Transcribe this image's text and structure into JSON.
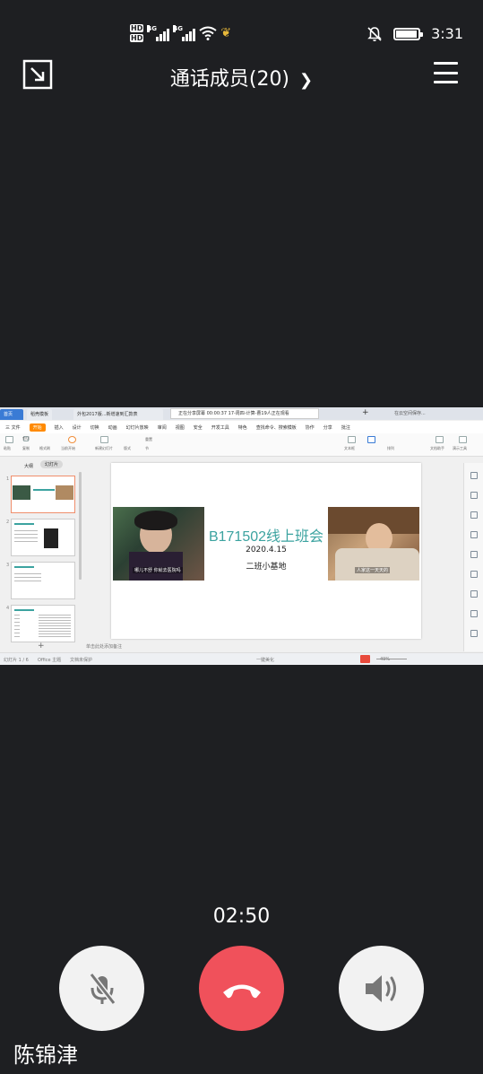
{
  "status_bar": {
    "hd1": "HD",
    "hd2": "HD",
    "net1": "4G",
    "net2": "4G",
    "time": "3:31",
    "battery_level": 0.9
  },
  "top_bar": {
    "title": "通话成员(20)",
    "chevron": "❯"
  },
  "shared_screen": {
    "tabs": {
      "home": "首页",
      "doc1": "稻壳模板",
      "doc2": "外包2017版...新增速到汇款表",
      "share_info": "正在分享屏幕   00:00:37   17-周四-计算-曹19人正在观看",
      "right": "在云空间保存..."
    },
    "menu": {
      "file": "三 文件",
      "start": "开始",
      "items": [
        "插入",
        "设计",
        "切换",
        "动画",
        "幻灯片放映",
        "审阅",
        "视图",
        "安全",
        "开发工具",
        "特色"
      ],
      "search": "查找命令、搜索模板",
      "collab": "协作",
      "share": "分享",
      "comment": "批注"
    },
    "ribbon_labels": [
      "粘贴",
      "剪切",
      "复制",
      "格式刷",
      "当前开始",
      "新建幻灯片",
      "版式",
      "节",
      "重置",
      "文本框",
      "排列",
      "文档助手",
      "演示工具"
    ],
    "panel": {
      "outline": "大纲",
      "slides": "幻灯片",
      "slide_nums": [
        "1",
        "2",
        "3",
        "4"
      ],
      "add": "+"
    },
    "slide": {
      "title": "B171502线上班会",
      "date": "2020.4.15",
      "subtitle": "二班小基地",
      "left_caption": "哪儿不舒 你就去医院吗",
      "right_caption": "人家这一天天的"
    },
    "notes": "单击此处添加备注",
    "statusline": {
      "page": "幻灯片 1 / 6",
      "theme": "Office 主题",
      "protect": "文档未保护",
      "beautify": "一键美化",
      "zoom": "49%"
    }
  },
  "call": {
    "duration": "02:50",
    "caller_name": "陈锦津",
    "colors": {
      "hangup": "#f0515b",
      "button_bg": "#f2f2f2",
      "icon": "#777777"
    }
  }
}
